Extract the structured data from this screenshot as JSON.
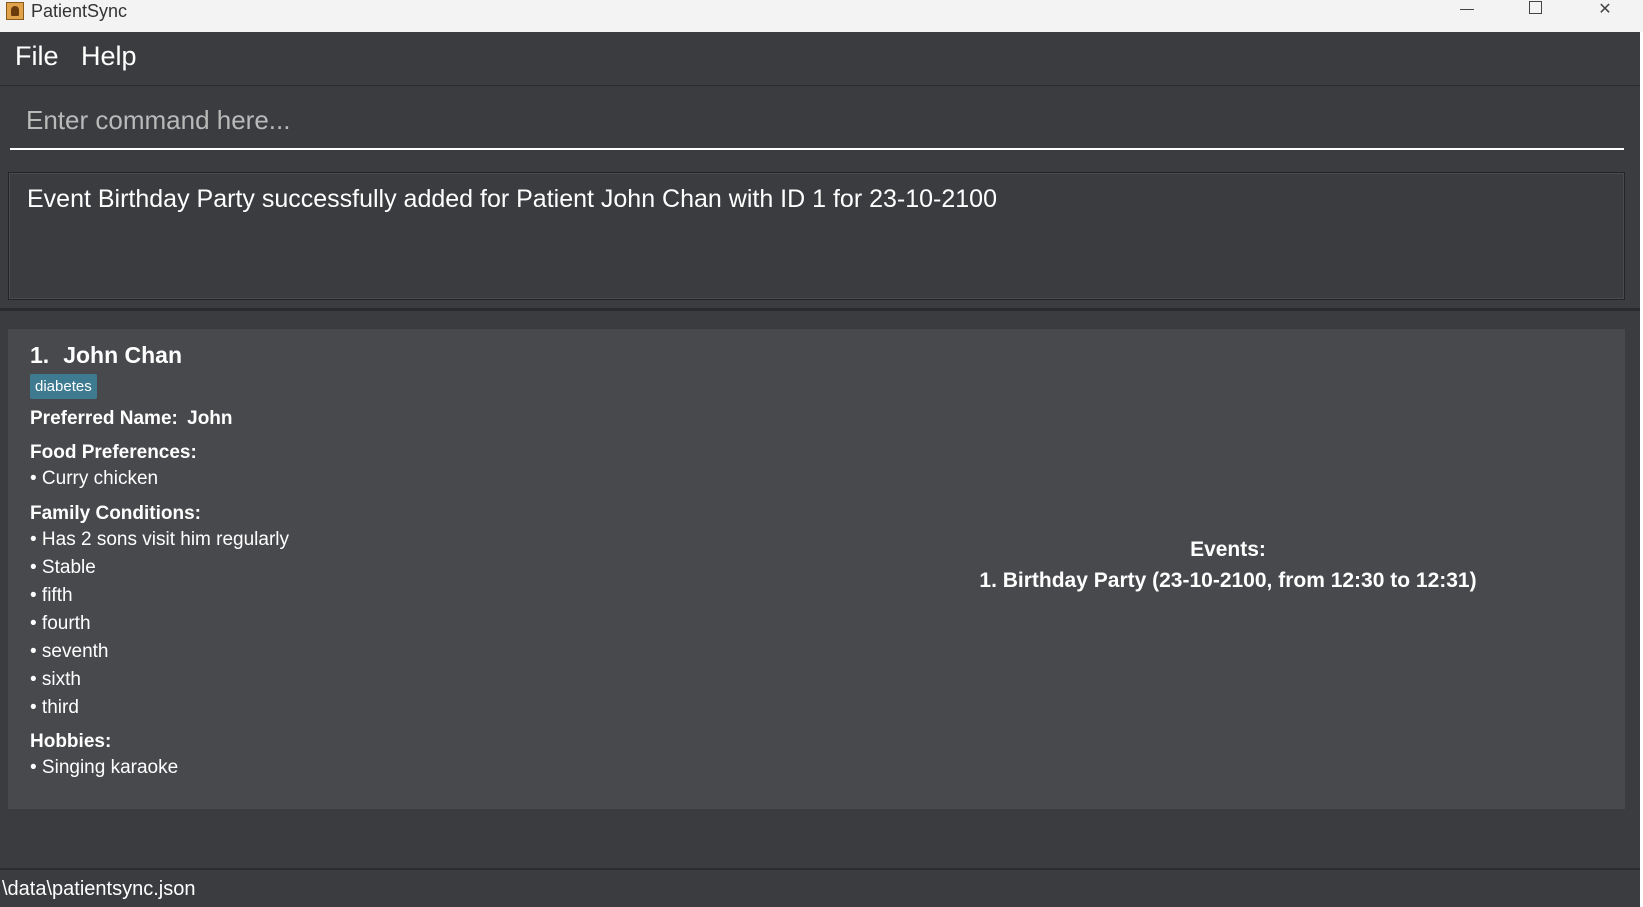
{
  "window": {
    "title": "PatientSync",
    "minimize": "—",
    "maximize": "☐",
    "close": "✕"
  },
  "menu": {
    "file": "File",
    "help": "Help"
  },
  "command": {
    "placeholder": "Enter command here...",
    "value": ""
  },
  "result": {
    "message": "Event Birthday Party successfully added for Patient John Chan with ID 1 for 23-10-2100"
  },
  "patients": [
    {
      "index": "1.",
      "name": "John Chan",
      "tag": "diabetes",
      "preferred_name_label": "Preferred Name:",
      "preferred_name": "John",
      "food_label": "Food Preferences:",
      "food": [
        "• Curry chicken"
      ],
      "family_label": "Family Conditions:",
      "family": [
        "• Has 2 sons visit him regularly",
        "• Stable",
        "• fifth",
        "• fourth",
        "• seventh",
        "• sixth",
        "• third"
      ],
      "hobbies_label": "Hobbies:",
      "hobbies": [
        "• Singing karaoke"
      ],
      "events_label": "Events:",
      "events": [
        "1. Birthday Party (23-10-2100, from 12:30 to 12:31)"
      ]
    }
  ],
  "status": {
    "path": "\\data\\patientsync.json"
  },
  "colors": {
    "background": "#3b3c3f",
    "card": "#48494c",
    "tag": "#3e7b91",
    "text": "#ffffff"
  }
}
